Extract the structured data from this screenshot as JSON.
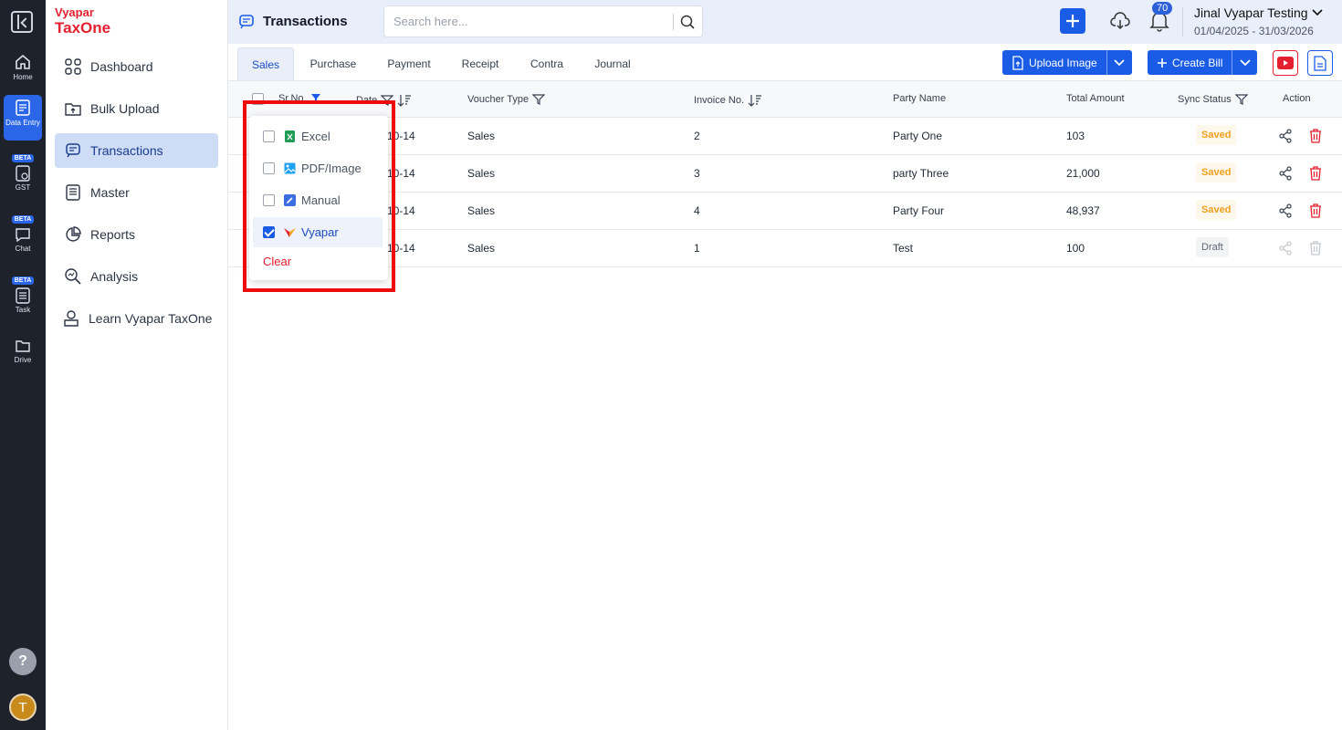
{
  "rail": {
    "items": [
      {
        "label": "Home"
      },
      {
        "label": "Data Entry"
      },
      {
        "label": "GST",
        "badge": "BETA"
      },
      {
        "label": "Chat",
        "badge": "BETA"
      },
      {
        "label": "Task",
        "badge": "BETA"
      },
      {
        "label": "Drive"
      }
    ],
    "help": "?",
    "avatar": "T"
  },
  "brand": {
    "line1": "Vyapar",
    "line2": "TaxOne"
  },
  "sidebar": {
    "items": [
      {
        "label": "Dashboard"
      },
      {
        "label": "Bulk Upload"
      },
      {
        "label": "Transactions"
      },
      {
        "label": "Master"
      },
      {
        "label": "Reports"
      },
      {
        "label": "Analysis"
      },
      {
        "label": "Learn Vyapar TaxOne"
      }
    ]
  },
  "header": {
    "title": "Transactions",
    "search_placeholder": "Search here...",
    "notifications": "70",
    "user": "Jinal Vyapar Testing",
    "fy": "01/04/2025 - 31/03/2026"
  },
  "tabs": [
    "Sales",
    "Purchase",
    "Payment",
    "Receipt",
    "Contra",
    "Journal"
  ],
  "toolbar": {
    "upload": "Upload Image",
    "create": "Create Bill"
  },
  "table": {
    "headers": {
      "sr": "Sr.No.",
      "date": "Date",
      "voucher": "Voucher Type",
      "invoice": "Invoice No.",
      "party": "Party Name",
      "amount": "Total Amount",
      "sync": "Sync Status",
      "action": "Action"
    },
    "rows": [
      {
        "date": "10-14",
        "voucher": "Sales",
        "invoice": "2",
        "party": "Party One",
        "amount": "103",
        "status": "Saved"
      },
      {
        "date": "10-14",
        "voucher": "Sales",
        "invoice": "3",
        "party": "party Three",
        "amount": "21,000",
        "status": "Saved"
      },
      {
        "date": "10-14",
        "voucher": "Sales",
        "invoice": "4",
        "party": "Party Four",
        "amount": "48,937",
        "status": "Saved"
      },
      {
        "date": "10-14",
        "voucher": "Sales",
        "invoice": "1",
        "party": "Test",
        "amount": "100",
        "status": "Draft"
      }
    ]
  },
  "filter_dropdown": {
    "options": [
      {
        "label": "Excel",
        "checked": false,
        "icon": "excel-icon"
      },
      {
        "label": "PDF/Image",
        "checked": false,
        "icon": "image-icon"
      },
      {
        "label": "Manual",
        "checked": false,
        "icon": "pencil-icon"
      },
      {
        "label": "Vyapar",
        "checked": true,
        "icon": "vyapar-logo-icon"
      }
    ],
    "clear": "Clear"
  },
  "colors": {
    "accent": "#1a5ce6",
    "danger": "#e41f2f",
    "highlight_box": "#ee0b0b",
    "saved": "#f0a020"
  }
}
